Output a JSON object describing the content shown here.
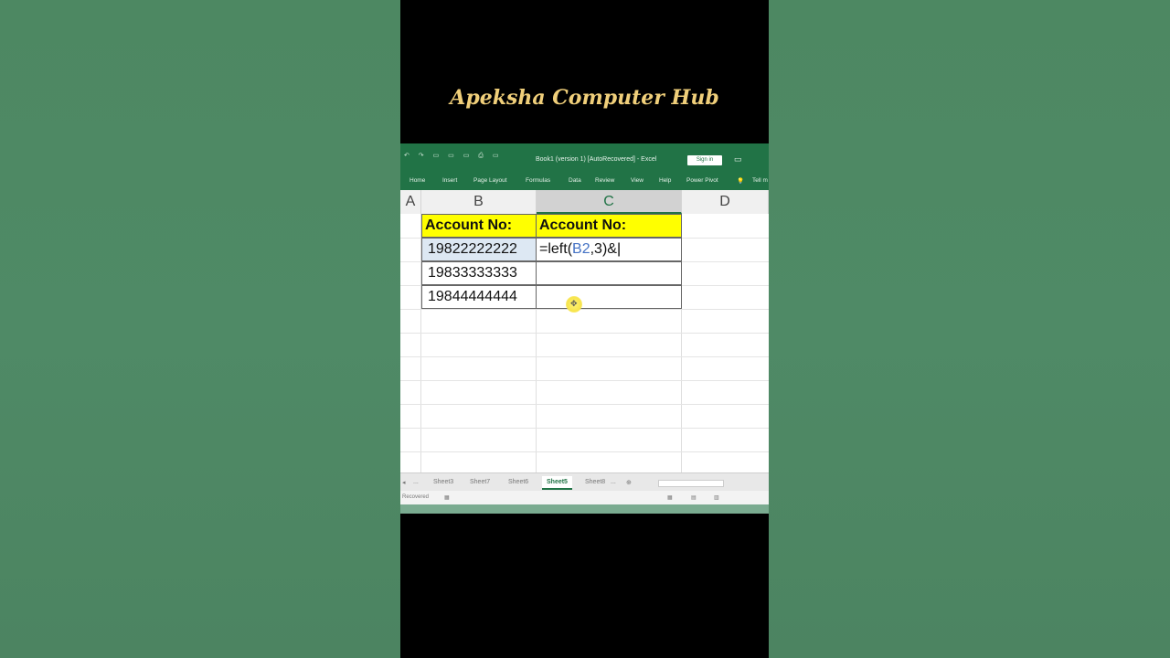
{
  "brand": {
    "title": "Apeksha Computer Hub"
  },
  "titlebar": {
    "quick_access": "↶ ↷ ▭ ▭ ▭ ⎙ ▭",
    "document": "Book1 (version 1) [AutoRecovered] - Excel",
    "sign_in": "Sign in",
    "window_icon": "▭"
  },
  "ribbon": {
    "tabs": [
      "Home",
      "Insert",
      "Page Layout",
      "Formulas",
      "Data",
      "Review",
      "View",
      "Help",
      "Power Pivot"
    ],
    "tell_me": "Tell m"
  },
  "columns": [
    "A",
    "B",
    "C",
    "D"
  ],
  "cells": {
    "B1": "Account No:",
    "C1": "Account No:",
    "B2": "19822222222",
    "B3": "19833333333",
    "B4": "19844444444",
    "C2_formula": {
      "prefix": "=left(",
      "ref": "B2",
      "suffix": ",3)&"
    }
  },
  "sheets": {
    "nav": "... ",
    "tabs": [
      "Sheet3",
      "Sheet7",
      "Sheet6",
      "Sheet5",
      "Sheet8"
    ],
    "active": "Sheet5",
    "more": "...",
    "add": "⊕"
  },
  "status": {
    "mode": "Recovered"
  },
  "colors": {
    "excel_green": "#217346",
    "header_fill": "#ffff00",
    "ref_blue": "#4472c4",
    "brand_gold": "#f0cf7a"
  }
}
